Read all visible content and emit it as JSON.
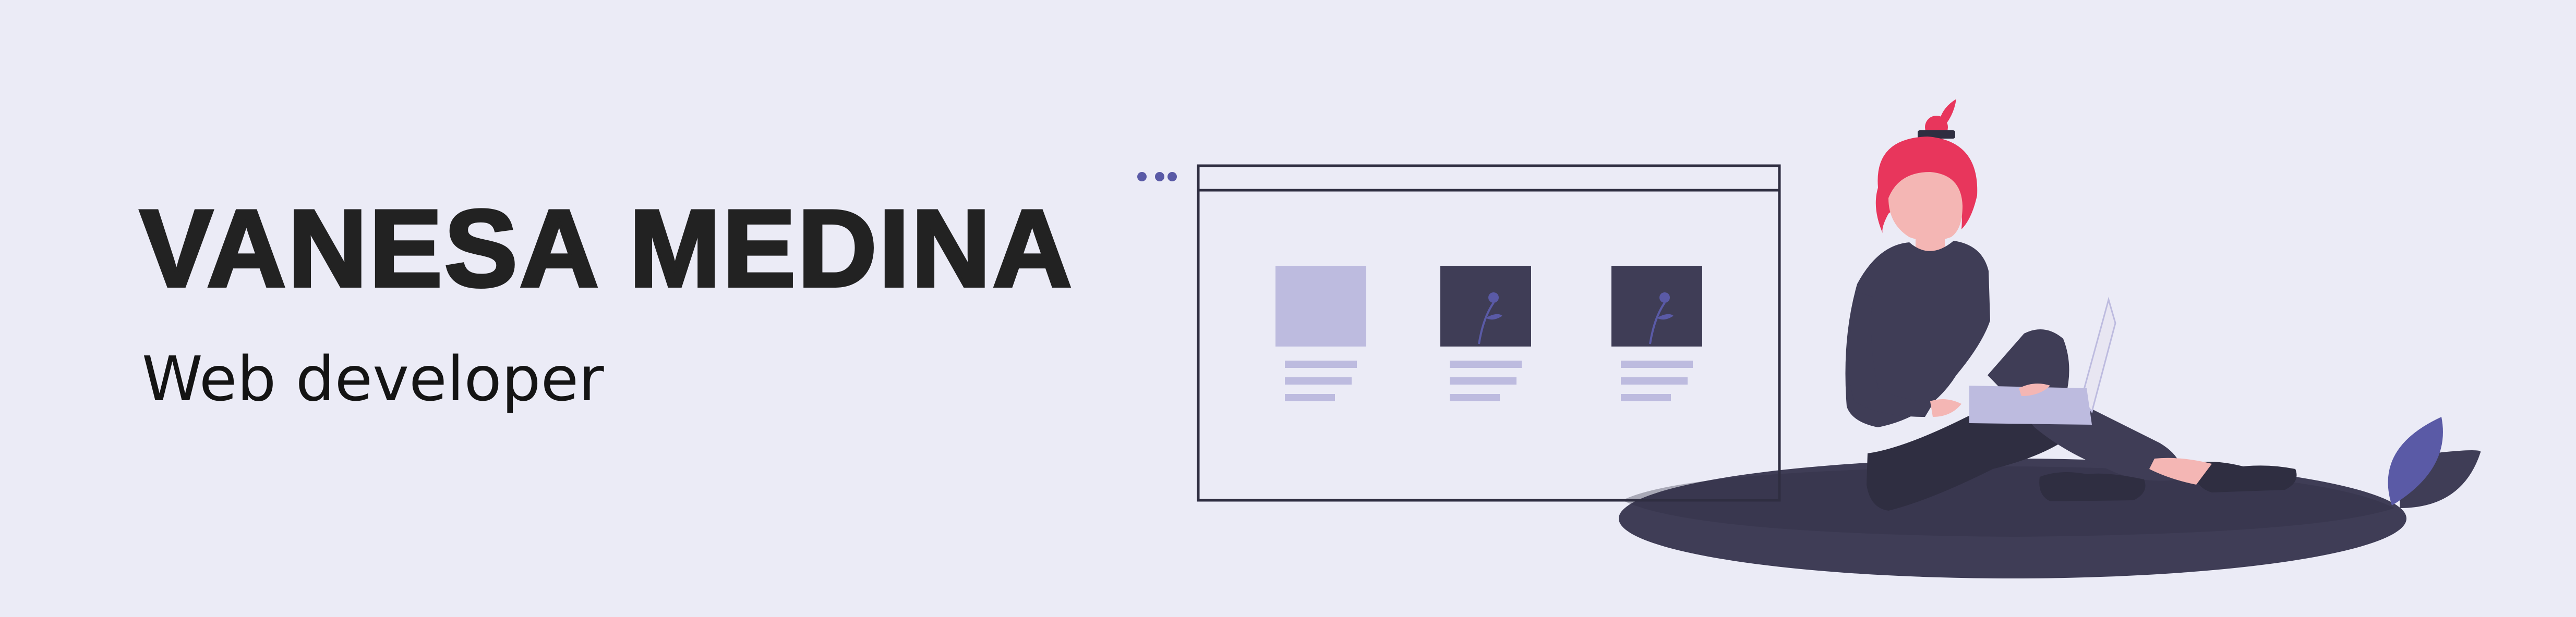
{
  "profile": {
    "name": "VANESA MEDINA",
    "role": "Web developer"
  },
  "illustration": {
    "icons": [
      "browser-window-icon",
      "person-with-laptop-icon",
      "plant-leaf-icon"
    ]
  },
  "colors": {
    "background": "#ebebf6",
    "heading": "#222222",
    "accent_blue": "#5a5aa6",
    "accent_red": "#e8365c",
    "dark": "#3f3d56",
    "skin": "#f4b6b4",
    "lavender": "#bdbbdf"
  }
}
